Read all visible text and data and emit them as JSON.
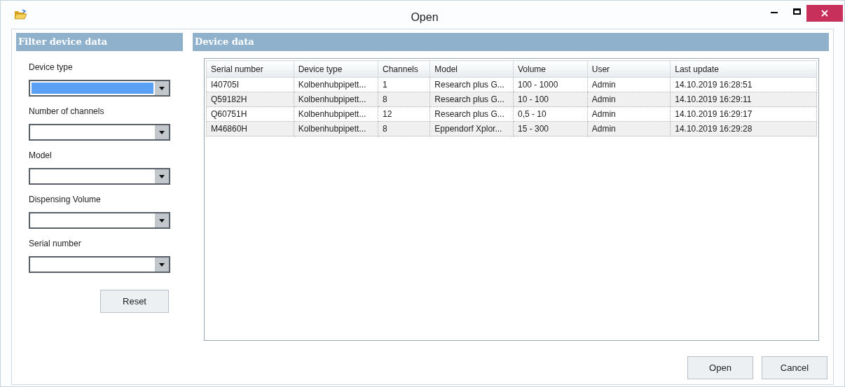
{
  "window": {
    "title": "Open"
  },
  "filter": {
    "title": "Filter device data",
    "fields": [
      {
        "label": "Device type",
        "focused": true
      },
      {
        "label": "Number of channels",
        "focused": false
      },
      {
        "label": "Model",
        "focused": false
      },
      {
        "label": "Dispensing Volume",
        "focused": false
      },
      {
        "label": "Serial number",
        "focused": false
      }
    ],
    "reset": "Reset"
  },
  "device_data": {
    "title": "Device data",
    "table": {
      "columns": [
        "Serial number",
        "Device type",
        "Channels",
        "Model",
        "Volume",
        "User",
        "Last update"
      ],
      "rows": [
        [
          "I40705I",
          "Kolbenhubpipett...",
          "1",
          "Research plus G...",
          "100 - 1000",
          "Admin",
          "14.10.2019 16:28:51"
        ],
        [
          "Q59182H",
          "Kolbenhubpipett...",
          "8",
          "Research plus G...",
          "10 - 100",
          "Admin",
          "14.10.2019 16:29:11"
        ],
        [
          "Q60751H",
          "Kolbenhubpipett...",
          "12",
          "Research plus G...",
          "0,5 - 10",
          "Admin",
          "14.10.2019 16:29:17"
        ],
        [
          "M46860H",
          "Kolbenhubpipett...",
          "8",
          "Eppendorf Xplor...",
          "15 - 300",
          "Admin",
          "14.10.2019 16:29:28"
        ]
      ]
    }
  },
  "buttons": [
    "Open",
    "Cancel"
  ]
}
